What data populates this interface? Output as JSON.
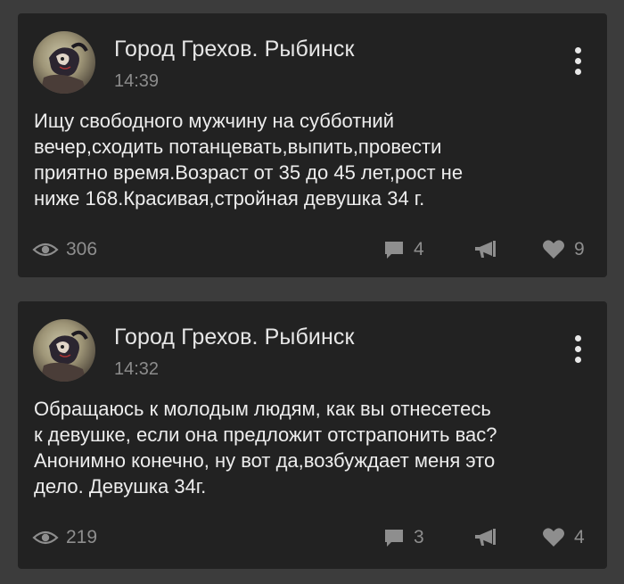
{
  "posts": [
    {
      "author": "Город Грехов. Рыбинск",
      "time": "14:39",
      "text": "Ищу свободного мужчину на субботний\nвечер,сходить потанцевать,выпить,провести\nприятно время.Возраст от 35 до 45 лет,рост не\nниже 168.Красивая,стройная девушка 34 г.",
      "views": "306",
      "comments": "4",
      "likes": "9"
    },
    {
      "author": "Город Грехов. Рыбинск",
      "time": "14:32",
      "text": "Обращаюсь к молодым людям, как  вы отнесетесь\nк девушке, если она предложит отстрапонить вас?\nАнонимно конечно, ну вот да,возбуждает меня это\nдело. Девушка 34г.",
      "views": "219",
      "comments": "3",
      "likes": "4"
    }
  ],
  "icons": {
    "views": "eye-icon",
    "comments": "comment-icon",
    "repost": "megaphone-icon",
    "likes": "heart-icon",
    "menu": "more-vertical-icon"
  },
  "colors": {
    "background": "#3c3c3c",
    "card": "#222222",
    "text": "#ededed",
    "muted": "#8e8e8e"
  }
}
